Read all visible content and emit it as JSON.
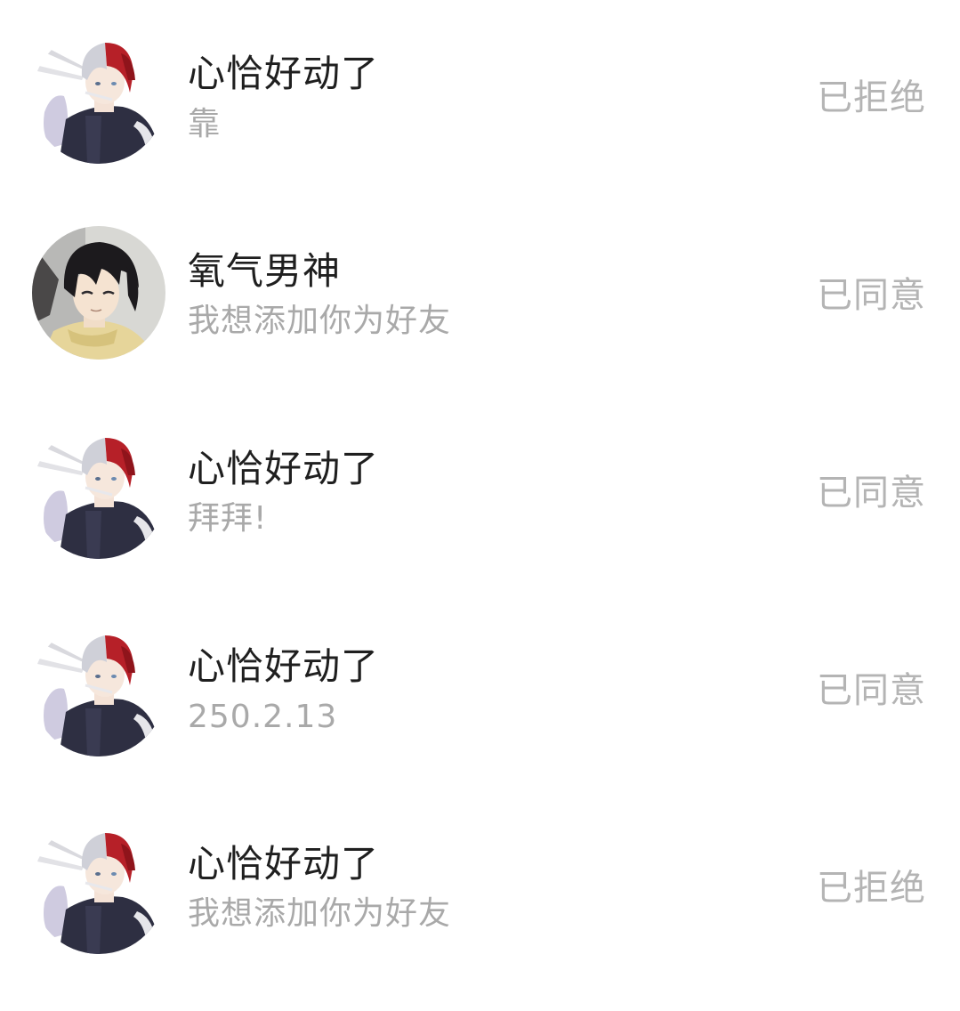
{
  "requests": [
    {
      "name": "心恰好动了",
      "message": "靠",
      "status": "已拒绝",
      "avatar_icon": "todoroki-avatar-icon"
    },
    {
      "name": "氧气男神",
      "message": "我想添加你为好友",
      "status": "已同意",
      "avatar_icon": "dark-hair-boy-avatar-icon"
    },
    {
      "name": "心恰好动了",
      "message": "拜拜!",
      "status": "已同意",
      "avatar_icon": "todoroki-avatar-icon"
    },
    {
      "name": "心恰好动了",
      "message": "250.2.13",
      "status": "已同意",
      "avatar_icon": "todoroki-avatar-icon"
    },
    {
      "name": "心恰好动了",
      "message": "我想添加你为好友",
      "status": "已拒绝",
      "avatar_icon": "todoroki-avatar-icon"
    }
  ],
  "colors": {
    "name_text": "#1f1f1f",
    "message_text": "#a9a9a9",
    "status_text": "#b4b4b4",
    "background": "#ffffff"
  }
}
